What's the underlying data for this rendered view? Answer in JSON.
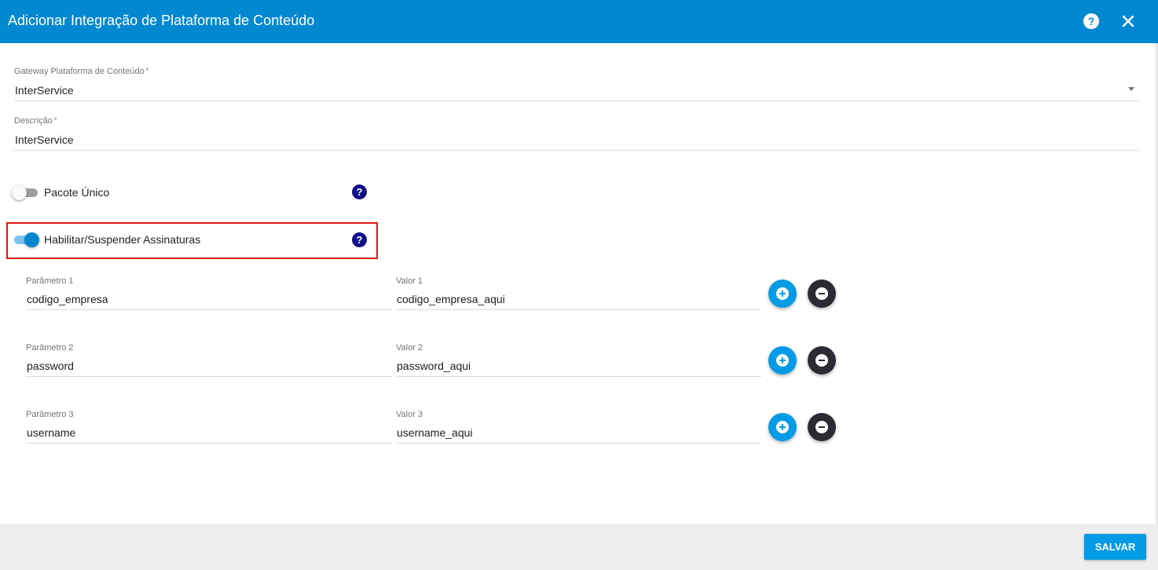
{
  "dialog": {
    "title": "Adicionar Integração de Plataforma de Conteúdo",
    "help_icon": "?",
    "close_icon": "close-icon"
  },
  "form": {
    "gateway": {
      "label": "Gateway Plataforma de Conteúdo",
      "required_mark": "*",
      "value": "InterService"
    },
    "descricao": {
      "label": "Descrição",
      "required_mark": "*",
      "value": "InterService"
    },
    "pacote_unico": {
      "label": "Pacote Único",
      "checked": false,
      "help": "?"
    },
    "habilitar_suspender": {
      "label": "Habilitar/Suspender Assinaturas",
      "checked": true,
      "help": "?"
    },
    "params": [
      {
        "param_label": "Parâmetro 1",
        "param_value": "codigo_empresa",
        "valor_label": "Valor 1",
        "valor_value": "codigo_empresa_aqui"
      },
      {
        "param_label": "Parâmetro 2",
        "param_value": "password",
        "valor_label": "Valor 2",
        "valor_value": "password_aqui"
      },
      {
        "param_label": "Parâmetro 3",
        "param_value": "username",
        "valor_label": "Valor 3",
        "valor_value": "username_aqui"
      }
    ]
  },
  "footer": {
    "save_label": "SALVAR"
  },
  "colors": {
    "header": "#0288d1",
    "accent": "#039be5",
    "remove": "#2b2b33",
    "help": "#11118a",
    "highlight": "#e01515"
  }
}
